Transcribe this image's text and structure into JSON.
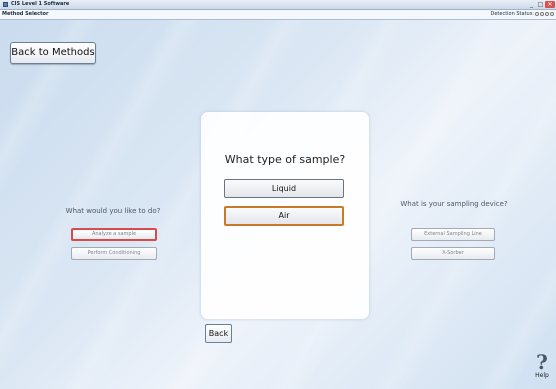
{
  "window": {
    "title": "CIS Level 1 Software",
    "minimize_glyph": "_",
    "maximize_glyph": "□",
    "close_glyph": "✕"
  },
  "menubar": {
    "title": "Method Selector",
    "status_label": "Detection Status:"
  },
  "nav": {
    "back_to_methods": "Back to Methods",
    "back": "Back"
  },
  "left": {
    "prompt": "What would you like to do?",
    "options": [
      "Analyze a sample",
      "Perform Conditioning"
    ],
    "selected_index": 0
  },
  "center": {
    "question": "What type of sample?",
    "options": [
      "Liquid",
      "Air"
    ],
    "selected_index": 1
  },
  "right": {
    "prompt": "What is your sampling device?",
    "options": [
      "External Sampling Line",
      "X-Sorber"
    ]
  },
  "help": {
    "glyph": "?",
    "label": "Help"
  },
  "colors": {
    "left_selected_border": "#d94a4a",
    "center_selected_border": "#c87a2a"
  },
  "icons": [
    "app-icon",
    "help-icon",
    "status-dot"
  ]
}
